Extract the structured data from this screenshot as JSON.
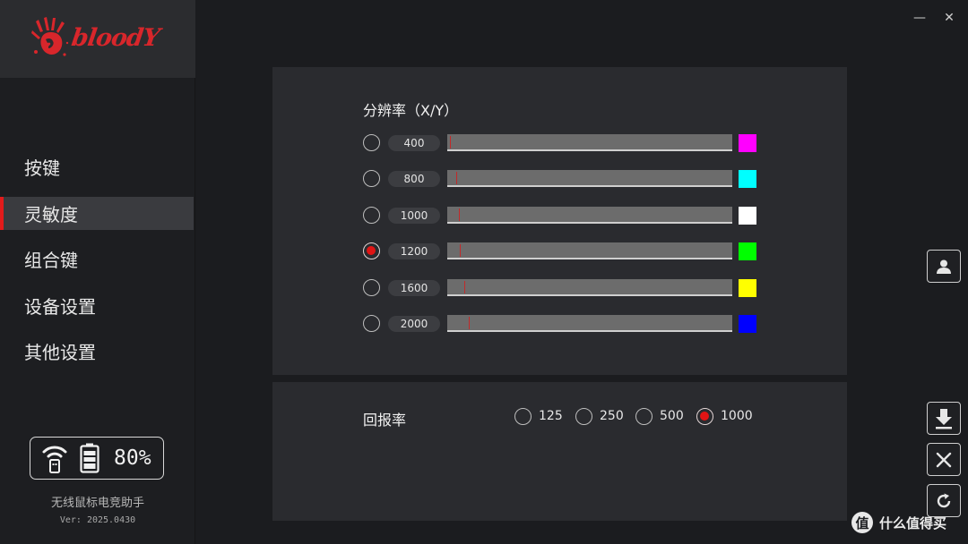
{
  "brand": {
    "logo_text": "bloodY",
    "logo_color": "#d8262b"
  },
  "window_controls": {
    "minimize": "—",
    "close": "✕"
  },
  "nav": {
    "items": [
      {
        "label": "按键",
        "active": false
      },
      {
        "label": "灵敏度",
        "active": true
      },
      {
        "label": "组合键",
        "active": false
      },
      {
        "label": "设备设置",
        "active": false
      },
      {
        "label": "其他设置",
        "active": false
      }
    ],
    "accent": "#e21b1b"
  },
  "status": {
    "battery": "80%",
    "app_name": "无线鼠标电竞助手",
    "version": "Ver: 2025.0430"
  },
  "dpi": {
    "title": "分辨率（X/Y）",
    "rows": [
      {
        "value": "400",
        "color": "#ff00ff",
        "selected": false,
        "level": 0.01
      },
      {
        "value": "800",
        "color": "#00ffff",
        "selected": false,
        "level": 0.03
      },
      {
        "value": "1000",
        "color": "#ffffff",
        "selected": false,
        "level": 0.04
      },
      {
        "value": "1200",
        "color": "#00ff00",
        "selected": true,
        "level": 0.045
      },
      {
        "value": "1600",
        "color": "#ffff00",
        "selected": false,
        "level": 0.06
      },
      {
        "value": "2000",
        "color": "#0000ff",
        "selected": false,
        "level": 0.075
      }
    ]
  },
  "report_rate": {
    "title": "回报率",
    "options": [
      {
        "label": "125",
        "selected": false
      },
      {
        "label": "250",
        "selected": false
      },
      {
        "label": "500",
        "selected": false
      },
      {
        "label": "1000",
        "selected": true
      }
    ]
  },
  "tools": [
    "user-icon",
    "download-icon",
    "close-icon",
    "refresh-icon"
  ],
  "watermark": {
    "glyph": "值",
    "text": "什么值得买"
  }
}
